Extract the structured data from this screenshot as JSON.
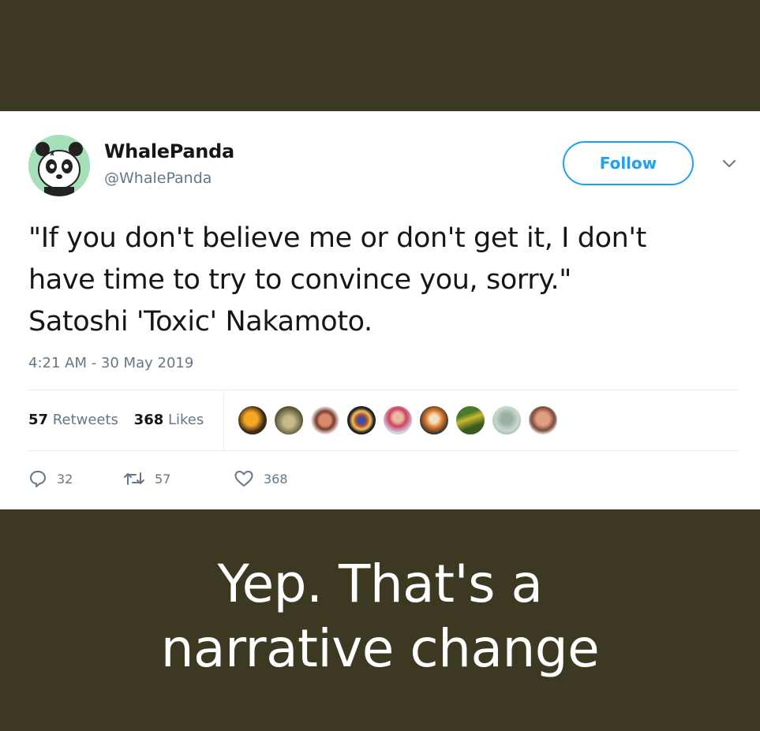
{
  "tweet": {
    "author": {
      "name": "WhalePanda",
      "handle": "@WhalePanda",
      "avatar_icon": "panda-avatar-icon"
    },
    "follow_label": "Follow",
    "menu_icon": "chevron-down-icon",
    "text_lines": [
      "\"If you don't believe me or don't get it, I don't",
      "have time to try to convince you, sorry.\"",
      "Satoshi 'Toxic' Nakamoto."
    ],
    "timestamp": "4:21 AM - 30 May 2019",
    "stats": {
      "retweets_count": "57",
      "retweets_label": "Retweets",
      "likes_count": "368",
      "likes_label": "Likes"
    },
    "liker_avatars": 9,
    "actions": {
      "reply_count": "32",
      "retweet_count": "57",
      "like_count": "368"
    },
    "accent_color": "#1da1f2"
  },
  "caption_lines": [
    "Yep. That's a",
    "narrative change"
  ],
  "colors": {
    "background": "#3d3822",
    "card": "#ffffff",
    "text_primary": "#14171a",
    "text_secondary": "#657786"
  }
}
